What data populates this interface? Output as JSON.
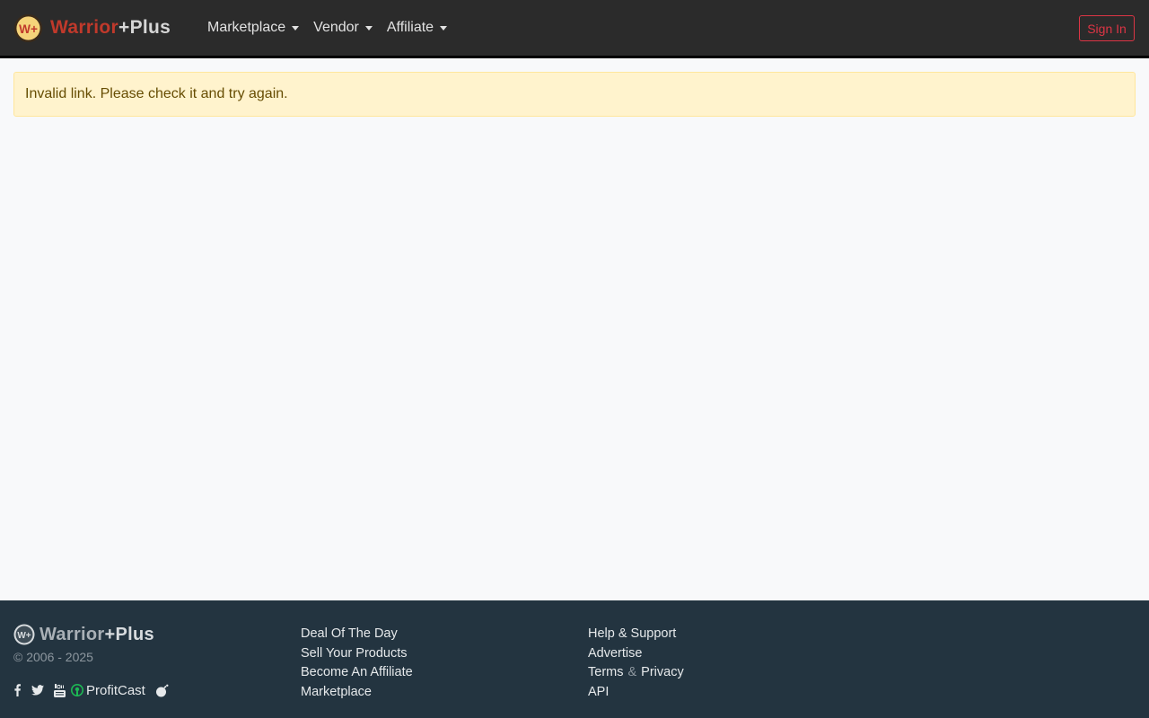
{
  "navbar": {
    "brand": {
      "part1": "Warrior",
      "part2": "+Plus",
      "logo_icon": "warriorplus-logo-icon",
      "logo_text": "W+"
    },
    "menu": [
      {
        "label": "Marketplace",
        "icon": "caret-down-icon"
      },
      {
        "label": "Vendor",
        "icon": "caret-down-icon"
      },
      {
        "label": "Affiliate",
        "icon": "caret-down-icon"
      }
    ],
    "signin_label": "Sign In"
  },
  "alert": {
    "message": "Invalid link. Please check it and try again."
  },
  "footer": {
    "brand": {
      "part1": "Warrior",
      "part2": "+Plus",
      "logo_text": "W+"
    },
    "copyright": "© 2006 - 2025",
    "social": {
      "icons": [
        "facebook-icon",
        "twitter-icon",
        "youtube-icon",
        "podcast-icon",
        "bomb-icon"
      ],
      "profitcast_label": "ProfitCast"
    },
    "col1": [
      "Deal Of The Day",
      "Sell Your Products",
      "Become An Affiliate",
      "Marketplace"
    ],
    "col2": {
      "help": "Help & Support",
      "advertise": "Advertise",
      "terms": "Terms",
      "amp": "&",
      "privacy": "Privacy",
      "api": "API"
    }
  },
  "colors": {
    "navbar_bg": "#2b2b2b",
    "brand_red": "#c0392b",
    "signin_red": "#dc3545",
    "alert_bg": "#fff3cd",
    "alert_text": "#664d03",
    "footer_bg": "#233440",
    "profitcast_green": "#1db954"
  }
}
